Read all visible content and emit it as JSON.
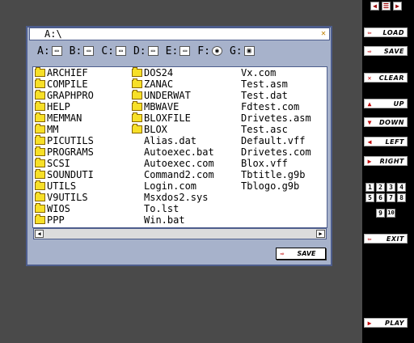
{
  "toolbar": {
    "mini_buttons": [
      "◀",
      "☰",
      "▶"
    ],
    "buttons": [
      {
        "label": "LOAD",
        "icon": "⇦"
      },
      {
        "label": "SAVE",
        "icon": "⇨"
      },
      {
        "label": "CLEAR",
        "icon": "✕"
      },
      {
        "label": "UP",
        "icon": "▲"
      },
      {
        "label": "DOWN",
        "icon": "▼"
      },
      {
        "label": "LEFT",
        "icon": "◀"
      },
      {
        "label": "RIGHT",
        "icon": "▶"
      },
      {
        "label": "EXIT",
        "icon": "⇦"
      },
      {
        "label": "PLAY",
        "icon": "▶"
      }
    ],
    "numbers": [
      "1",
      "2",
      "3",
      "4",
      "5",
      "6",
      "7",
      "8"
    ],
    "numbers_row2": [
      "9",
      "10"
    ]
  },
  "dialog": {
    "path": "A:\\",
    "close_icon": "✕",
    "drives": [
      {
        "letter": "A:",
        "icon": "▭"
      },
      {
        "letter": "B:",
        "icon": "▭"
      },
      {
        "letter": "C:",
        "icon": "▭"
      },
      {
        "letter": "D:",
        "icon": "▭"
      },
      {
        "letter": "E:",
        "icon": "▭"
      },
      {
        "letter": "F:",
        "icon": "◉"
      },
      {
        "letter": "G:",
        "icon": "▣"
      }
    ],
    "columns": [
      [
        {
          "name": "ARCHIEF",
          "folder": true
        },
        {
          "name": "COMPILE",
          "folder": true
        },
        {
          "name": "GRAPHPRO",
          "folder": true
        },
        {
          "name": "HELP",
          "folder": true
        },
        {
          "name": "MEMMAN",
          "folder": true
        },
        {
          "name": "MM",
          "folder": true
        },
        {
          "name": "PICUTILS",
          "folder": true
        },
        {
          "name": "PROGRAMS",
          "folder": true
        },
        {
          "name": "SCSI",
          "folder": true
        },
        {
          "name": "SOUNDUTI",
          "folder": true
        },
        {
          "name": "UTILS",
          "folder": true
        },
        {
          "name": "V9UTILS",
          "folder": true
        },
        {
          "name": "WIOS",
          "folder": true
        },
        {
          "name": "PPP",
          "folder": true
        }
      ],
      [
        {
          "name": "DOS24",
          "folder": true
        },
        {
          "name": "ZANAC",
          "folder": true
        },
        {
          "name": "UNDERWAT",
          "folder": true
        },
        {
          "name": "MBWAVE",
          "folder": true
        },
        {
          "name": "BLOXFILE",
          "folder": true
        },
        {
          "name": "BLOX",
          "folder": true
        },
        {
          "name": "Alias.dat",
          "folder": false
        },
        {
          "name": "Autoexec.bat",
          "folder": false
        },
        {
          "name": "Autoexec.com",
          "folder": false
        },
        {
          "name": "Command2.com",
          "folder": false
        },
        {
          "name": "Login.com",
          "folder": false
        },
        {
          "name": "Msxdos2.sys",
          "folder": false
        },
        {
          "name": "To.lst",
          "folder": false
        },
        {
          "name": "Win.bat",
          "folder": false
        }
      ],
      [
        {
          "name": "Vx.com",
          "folder": false
        },
        {
          "name": "Test.asm",
          "folder": false
        },
        {
          "name": "Test.dat",
          "folder": false
        },
        {
          "name": "Fdtest.com",
          "folder": false
        },
        {
          "name": "Drivetes.asm",
          "folder": false
        },
        {
          "name": "Test.asc",
          "folder": false
        },
        {
          "name": "Default.vff",
          "folder": false
        },
        {
          "name": "Drivetes.com",
          "folder": false
        },
        {
          "name": "Blox.vff",
          "folder": false
        },
        {
          "name": "Tbtitle.g9b",
          "folder": false
        },
        {
          "name": "Tblogo.g9b",
          "folder": false
        }
      ]
    ],
    "scroll_left": "◀",
    "scroll_right": "▶",
    "save_label": "SAVE",
    "save_icon": "⇨"
  }
}
